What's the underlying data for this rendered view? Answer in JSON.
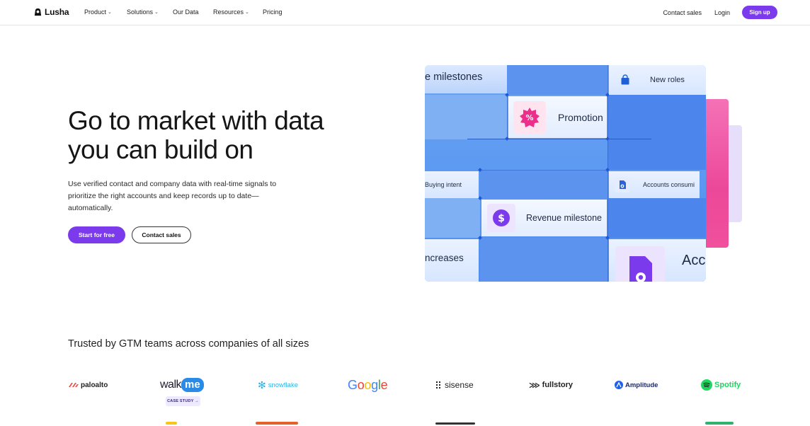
{
  "nav": {
    "logo": "Lusha",
    "links": [
      {
        "label": "Product",
        "has_menu": true
      },
      {
        "label": "Solutions",
        "has_menu": true
      },
      {
        "label": "Our Data",
        "has_menu": false
      },
      {
        "label": "Resources",
        "has_menu": true
      },
      {
        "label": "Pricing",
        "has_menu": false
      }
    ],
    "contact_sales": "Contact sales",
    "login": "Login",
    "signup": "Sign up"
  },
  "hero": {
    "title": "Go to market with data you can build on",
    "subtitle": "Use verified contact and company data with real-time signals to prioritize the right accounts and keep records up to date—automatically.",
    "cta_primary": "Start for free",
    "cta_secondary": "Contact sales"
  },
  "visual": {
    "tiles": {
      "milestones": "e milestones",
      "new_roles": "New roles",
      "promotion": "Promotion",
      "buying_intent": "Buying intent",
      "accounts_consuming": "Accounts consumi",
      "revenue_milestone": "Revenue milestone",
      "increases": "ncreases",
      "acc": "Acc"
    }
  },
  "trusted": {
    "heading": "Trusted by GTM teams across companies of all sizes",
    "case_study": "CASE STUDY →",
    "brands": {
      "paloalto": "paloalto",
      "walkme_walk": "walk",
      "walkme_me": "me",
      "snowflake": "snowflake",
      "google": [
        "G",
        "o",
        "o",
        "g",
        "l",
        "e"
      ],
      "sisense": "sisense",
      "fullstory": "fullstory",
      "amplitude": "Amplitude",
      "spotify": "Spotify"
    }
  },
  "colors": {
    "brand_purple": "#7c3aed",
    "visual_blue": "#4f8ef0",
    "pink": "#ec4899"
  }
}
